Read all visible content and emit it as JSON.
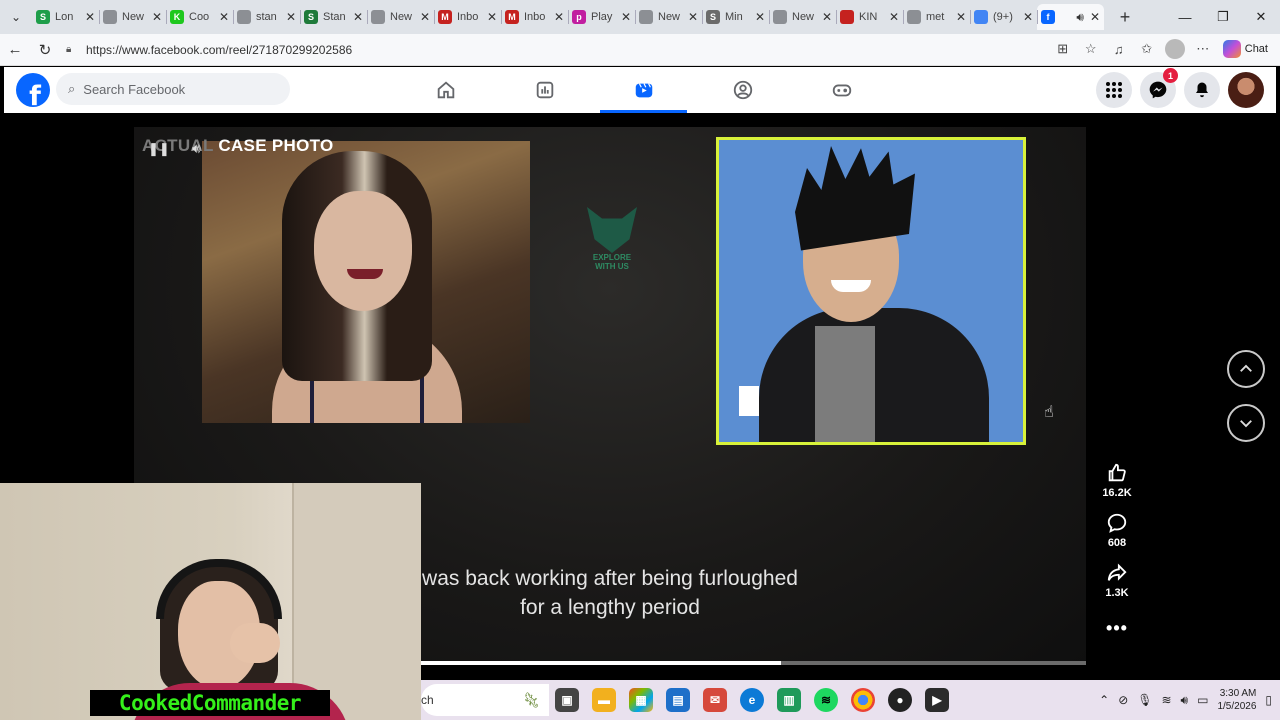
{
  "browser": {
    "tabs": [
      {
        "label": "Lon",
        "fav": "S",
        "color": "#1e9e4a"
      },
      {
        "label": "New",
        "fav": "",
        "color": "#8c8f94"
      },
      {
        "label": "Coo",
        "fav": "K",
        "color": "#1ec81e"
      },
      {
        "label": "stan",
        "fav": "",
        "color": "#8c8f94"
      },
      {
        "label": "Stan",
        "fav": "S",
        "color": "#1e7a3a"
      },
      {
        "label": "New",
        "fav": "",
        "color": "#8c8f94"
      },
      {
        "label": "Inbo",
        "fav": "M",
        "color": "#c5221f"
      },
      {
        "label": "Inbo",
        "fav": "M",
        "color": "#c5221f"
      },
      {
        "label": "Play",
        "fav": "p",
        "color": "#c11ea0"
      },
      {
        "label": "New",
        "fav": "",
        "color": "#8c8f94"
      },
      {
        "label": "Min",
        "fav": "S",
        "color": "#6b6b6b"
      },
      {
        "label": "New",
        "fav": "",
        "color": "#8c8f94"
      },
      {
        "label": "KIN",
        "fav": "",
        "color": "#c5221f"
      },
      {
        "label": "met",
        "fav": "",
        "color": "#8c8f94"
      },
      {
        "label": "(9+)",
        "fav": "",
        "color": "#4285f4"
      },
      {
        "label": "",
        "fav": "f",
        "color": "#0866ff",
        "active": true
      }
    ],
    "url": "https://www.facebook.com/reel/271870299202586",
    "copilot_label": "Chat"
  },
  "facebook": {
    "search_placeholder": "Search Facebook",
    "messenger_badge": "1"
  },
  "reel": {
    "label_dim": "ACTUAL",
    "label_main": "CASE PHOTO",
    "logo_line1": "EXPLORE",
    "logo_line2": "WITH US",
    "caption_line1": "was back working after being furloughed",
    "caption_line2": "for a lengthy period",
    "progress": 0.68,
    "likes": "16.2K",
    "comments": "608",
    "shares": "1.3K"
  },
  "webcam": {
    "name": "CookedCommander"
  },
  "taskbar": {
    "search_text": "ch",
    "time": "3:30 AM",
    "date": "1/5/2026"
  }
}
